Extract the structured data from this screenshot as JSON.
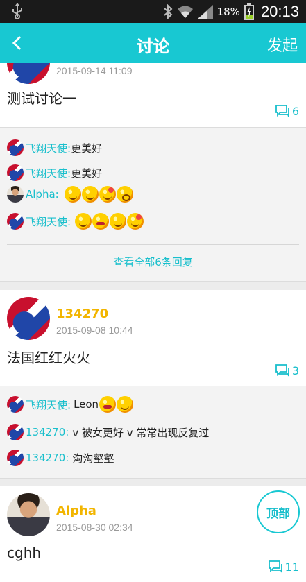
{
  "status_bar": {
    "battery": "18%",
    "time": "20:13"
  },
  "header": {
    "title": "讨论",
    "action": "发起"
  },
  "posts": [
    {
      "author": "",
      "date": "2015-09-14 11:09",
      "text": "测试讨论一",
      "comment_count": "6",
      "replies": [
        {
          "name": "飞翔天使:",
          "text": "更美好",
          "emojis": []
        },
        {
          "name": "飞翔天使:",
          "text": "更美好",
          "emojis": []
        },
        {
          "name": "Alpha:",
          "text": "",
          "emojis": [
            "sad-emoji",
            "sad-emoji",
            "laugh-emoji",
            "surprised-emoji"
          ]
        },
        {
          "name": "飞翔天使:",
          "text": "",
          "emojis": [
            "sly-emoji",
            "grin-emoji",
            "shy-emoji",
            "laugh-emoji"
          ]
        }
      ],
      "view_all": "查看全部6条回复"
    },
    {
      "author": "134270",
      "date": "2015-09-08 10:44",
      "text": "法国红红火火",
      "comment_count": "3",
      "replies": [
        {
          "name": "飞翔天使:",
          "text": "Leon",
          "emojis": [
            "grin-emoji",
            "angry-emoji"
          ]
        },
        {
          "name": "134270:",
          "text": "v 被女更好 v 常常出现反复过",
          "emojis": []
        },
        {
          "name": "134270:",
          "text": "沟沟壑壑",
          "emojis": []
        }
      ]
    },
    {
      "author": "Alpha",
      "date": "2015-08-30 02:34",
      "text": "cghh",
      "comment_count": "11"
    }
  ],
  "top_button": "顶部",
  "colors": {
    "accent": "#18c8d2",
    "author": "#f2b500",
    "link": "#18bfcc"
  }
}
